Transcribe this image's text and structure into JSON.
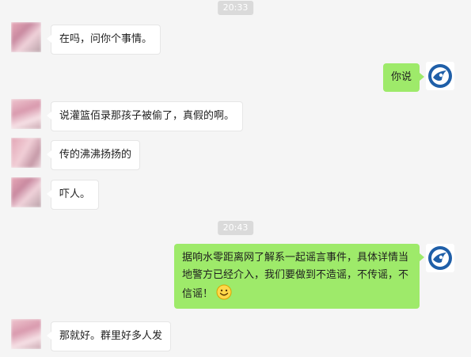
{
  "colors": {
    "background": "#f5f5f5",
    "incoming_bubble": "#ffffff",
    "outgoing_bubble": "#9eea6a",
    "timestamp_bg": "#dadada",
    "self_avatar": "#1f5fa8"
  },
  "messages": [
    {
      "type": "time",
      "text": "20:33"
    },
    {
      "type": "incoming",
      "text": "在吗，问你个事情。"
    },
    {
      "type": "outgoing",
      "text": "你说"
    },
    {
      "type": "incoming",
      "text": "说灌篮佰录那孩子被偷了，真假的啊。"
    },
    {
      "type": "incoming",
      "text": "传的沸沸扬扬的"
    },
    {
      "type": "incoming",
      "text": "吓人。"
    },
    {
      "type": "time",
      "text": "20:43"
    },
    {
      "type": "outgoing",
      "text": "据响水零距离网了解系一起谣言事件，具体详情当地警方已经介入，我们要做到不造谣，不传谣，不信谣！",
      "emoji": "smile-emoji"
    },
    {
      "type": "incoming",
      "text": "那就好。群里好多人发"
    }
  ]
}
